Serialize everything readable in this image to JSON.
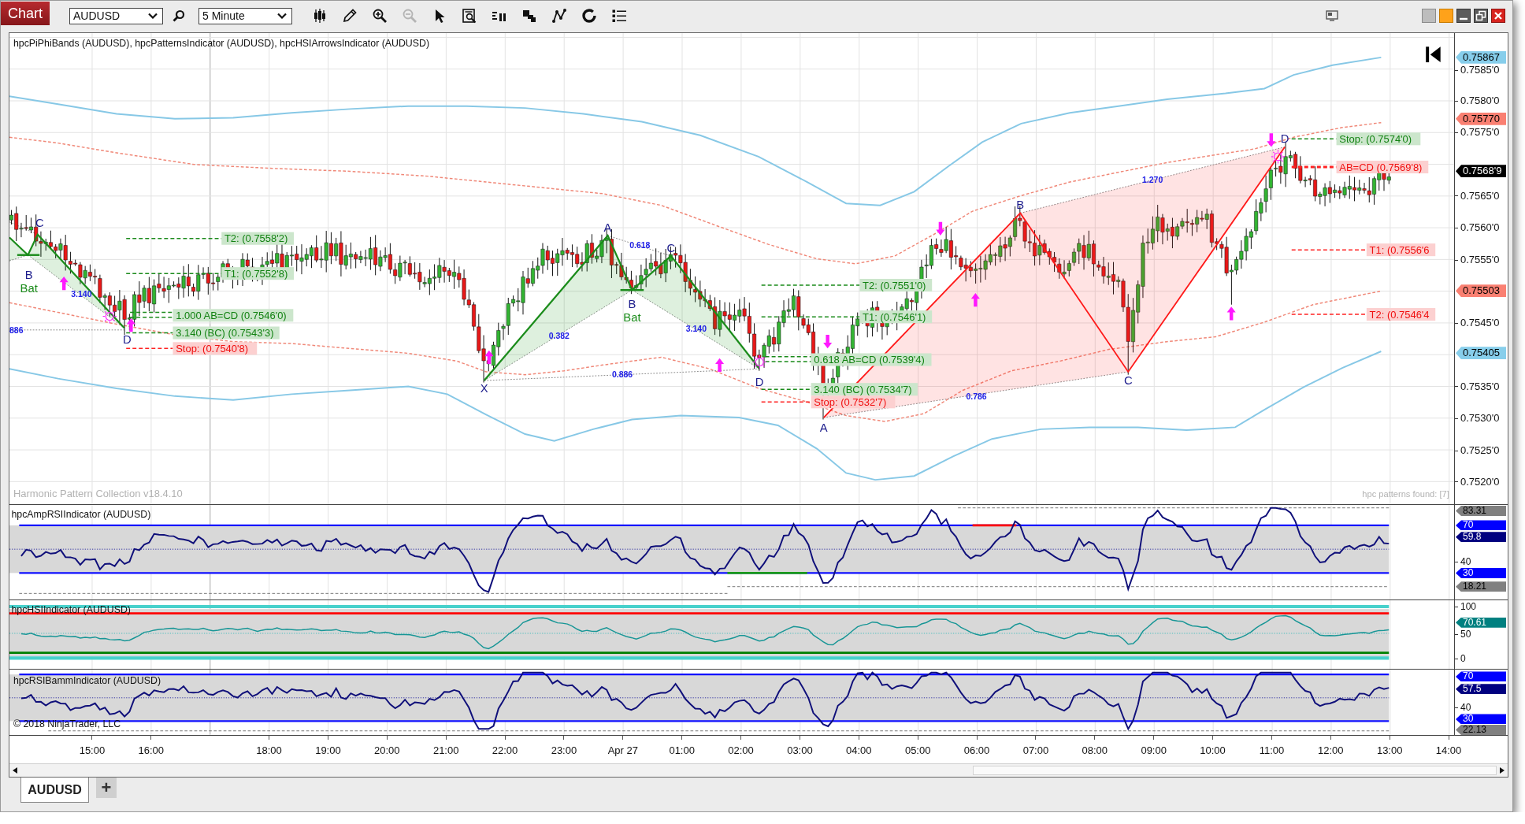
{
  "window": {
    "title": "Chart"
  },
  "toolbar": {
    "instrument": "AUDUSD",
    "interval": "5 Minute",
    "tools": [
      {
        "kind": "candles",
        "disabled": false
      },
      {
        "kind": "pencil",
        "disabled": false
      },
      {
        "kind": "zoom_in",
        "disabled": false
      },
      {
        "kind": "zoom_out",
        "disabled": true
      },
      {
        "kind": "pointer",
        "disabled": false
      },
      {
        "kind": "data_box",
        "disabled": false
      },
      {
        "kind": "bars",
        "disabled": false
      },
      {
        "kind": "squares",
        "disabled": false
      },
      {
        "kind": "nodes",
        "disabled": false
      },
      {
        "kind": "ring",
        "disabled": false
      },
      {
        "kind": "list",
        "disabled": false
      }
    ]
  },
  "main_panel": {
    "title": "hpcPiPhiBands (AUDUSD), hpcPatternsIndicator (AUDUSD), hpcHSIArrowsIndicator (AUDUSD)",
    "patterns": [
      {
        "kind": "bullish",
        "name": "Bat",
        "points": [
          "B",
          "C",
          "D"
        ],
        "ratios": [
          "3.140",
          "886"
        ],
        "levels": [
          {
            "kind": "target",
            "text": "T2: (0.7558'2)"
          },
          {
            "kind": "target",
            "text": "T1: (0.7552'8)"
          },
          {
            "kind": "target",
            "text": "1.000 AB=CD (0.7546'0)"
          },
          {
            "kind": "target",
            "text": "3.140 (BC) (0.7543'3)"
          },
          {
            "kind": "stop",
            "text": "Stop: (0.7540'8)"
          }
        ]
      },
      {
        "kind": "bullish",
        "name": "Bat",
        "points": [
          "X",
          "A",
          "B",
          "C",
          "D"
        ],
        "ratios": [
          "0.382",
          "0.618",
          "3.140",
          "0.886"
        ],
        "levels": [
          {
            "kind": "target",
            "text": "T2: (0.7551'0)"
          },
          {
            "kind": "target",
            "text": "T1: (0.7546'1)"
          },
          {
            "kind": "target",
            "text": "0.618 AB=CD (0.7539'4)"
          },
          {
            "kind": "target",
            "text": "3.140 (BC) (0.7534'7)"
          },
          {
            "kind": "stop",
            "text": "Stop: (0.7532'7)"
          }
        ]
      },
      {
        "kind": "bearish",
        "points": [
          "A",
          "B",
          "C",
          "D"
        ],
        "ratios": [
          "1.270",
          "0.786"
        ],
        "levels": [
          {
            "kind": "stop",
            "text": "Stop: (0.7574'0)"
          },
          {
            "kind": "target",
            "text": "AB=CD (0.7569'8)"
          },
          {
            "kind": "target",
            "text": "T1: (0.7556'6"
          },
          {
            "kind": "target",
            "text": "T2: (0.7546'4"
          }
        ]
      }
    ],
    "version": "Harmonic Pattern Collection v18.4.10",
    "pattern_count": "hpc patterns found: [7]",
    "price_axis": [
      {
        "kind": "tag",
        "label": "0.75867",
        "color": "#87ceeb"
      },
      {
        "kind": "tick",
        "label": "0.7585'0"
      },
      {
        "kind": "tick",
        "label": "0.7580'0"
      },
      {
        "kind": "tag",
        "label": "0.75770",
        "color": "#fa8072"
      },
      {
        "kind": "tick",
        "label": "0.7575'0"
      },
      {
        "kind": "tag",
        "label": "0.7568'9",
        "color": "#000000"
      },
      {
        "kind": "tick",
        "label": "0.7565'0"
      },
      {
        "kind": "tick",
        "label": "0.7560'0"
      },
      {
        "kind": "tick",
        "label": "0.7555'0"
      },
      {
        "kind": "tag",
        "label": "0.75503",
        "color": "#fa8072"
      },
      {
        "kind": "tick",
        "label": "0.7545'0"
      },
      {
        "kind": "tag",
        "label": "0.75405",
        "color": "#87ceeb"
      },
      {
        "kind": "tick",
        "label": "0.7535'0"
      },
      {
        "kind": "tick",
        "label": "0.7530'0"
      },
      {
        "kind": "tick",
        "label": "0.7525'0"
      },
      {
        "kind": "tick",
        "label": "0.7520'0"
      }
    ]
  },
  "indicator_panels": [
    {
      "kind": "amp_rsi",
      "title": "hpcAmpRSIIndicator (AUDUSD)",
      "axis": [
        {
          "kind": "tag",
          "label": "83.31",
          "color": "#808080"
        },
        {
          "kind": "tag",
          "label": "70",
          "color": "#0000ff"
        },
        {
          "kind": "tag",
          "label": "59.8",
          "color": "#000080"
        },
        {
          "kind": "tick",
          "label": "40"
        },
        {
          "kind": "tag",
          "label": "30",
          "color": "#0000ff"
        },
        {
          "kind": "tag",
          "label": "18.21",
          "color": "#808080"
        }
      ]
    },
    {
      "kind": "hsi",
      "title": "hpcHSIIndicator (AUDUSD)",
      "axis": [
        {
          "kind": "tick",
          "label": "100"
        },
        {
          "kind": "tag",
          "label": "70.61",
          "color": "#008080"
        },
        {
          "kind": "tick",
          "label": "50"
        },
        {
          "kind": "tick",
          "label": "0"
        }
      ]
    },
    {
      "kind": "rsi_bamm",
      "title": "hpcRSIBammIndicator (AUDUSD)",
      "copyright": "© 2018 NinjaTrader, LLC",
      "axis": [
        {
          "kind": "tag",
          "label": "70",
          "color": "#0000ff"
        },
        {
          "kind": "tag",
          "label": "57.5",
          "color": "#000080"
        },
        {
          "kind": "tick",
          "label": "40"
        },
        {
          "kind": "tag",
          "label": "30",
          "color": "#0000ff"
        },
        {
          "kind": "tag",
          "label": "22.13",
          "color": "#808080"
        }
      ]
    }
  ],
  "time_axis": [
    {
      "kind": "label",
      "text": "15:00"
    },
    {
      "kind": "label",
      "text": "16:00"
    },
    {
      "kind": "session_break"
    },
    {
      "kind": "label",
      "text": "18:00"
    },
    {
      "kind": "label",
      "text": "19:00"
    },
    {
      "kind": "label",
      "text": "20:00"
    },
    {
      "kind": "label",
      "text": "21:00"
    },
    {
      "kind": "label",
      "text": "22:00"
    },
    {
      "kind": "label",
      "text": "23:00"
    },
    {
      "kind": "label",
      "text": "Apr 27"
    },
    {
      "kind": "label",
      "text": "01:00"
    },
    {
      "kind": "label",
      "text": "02:00"
    },
    {
      "kind": "label",
      "text": "03:00"
    },
    {
      "kind": "label",
      "text": "04:00"
    },
    {
      "kind": "label",
      "text": "05:00"
    },
    {
      "kind": "label",
      "text": "06:00"
    },
    {
      "kind": "label",
      "text": "07:00"
    },
    {
      "kind": "label",
      "text": "08:00"
    },
    {
      "kind": "label",
      "text": "09:00"
    },
    {
      "kind": "label",
      "text": "10:00"
    },
    {
      "kind": "label",
      "text": "11:00"
    },
    {
      "kind": "label",
      "text": "12:00"
    },
    {
      "kind": "label",
      "text": "13:00"
    },
    {
      "kind": "label",
      "text": "14:00"
    }
  ],
  "tabs": [
    {
      "label": "AUDUSD",
      "selected": true
    }
  ],
  "add_tab": "+"
}
